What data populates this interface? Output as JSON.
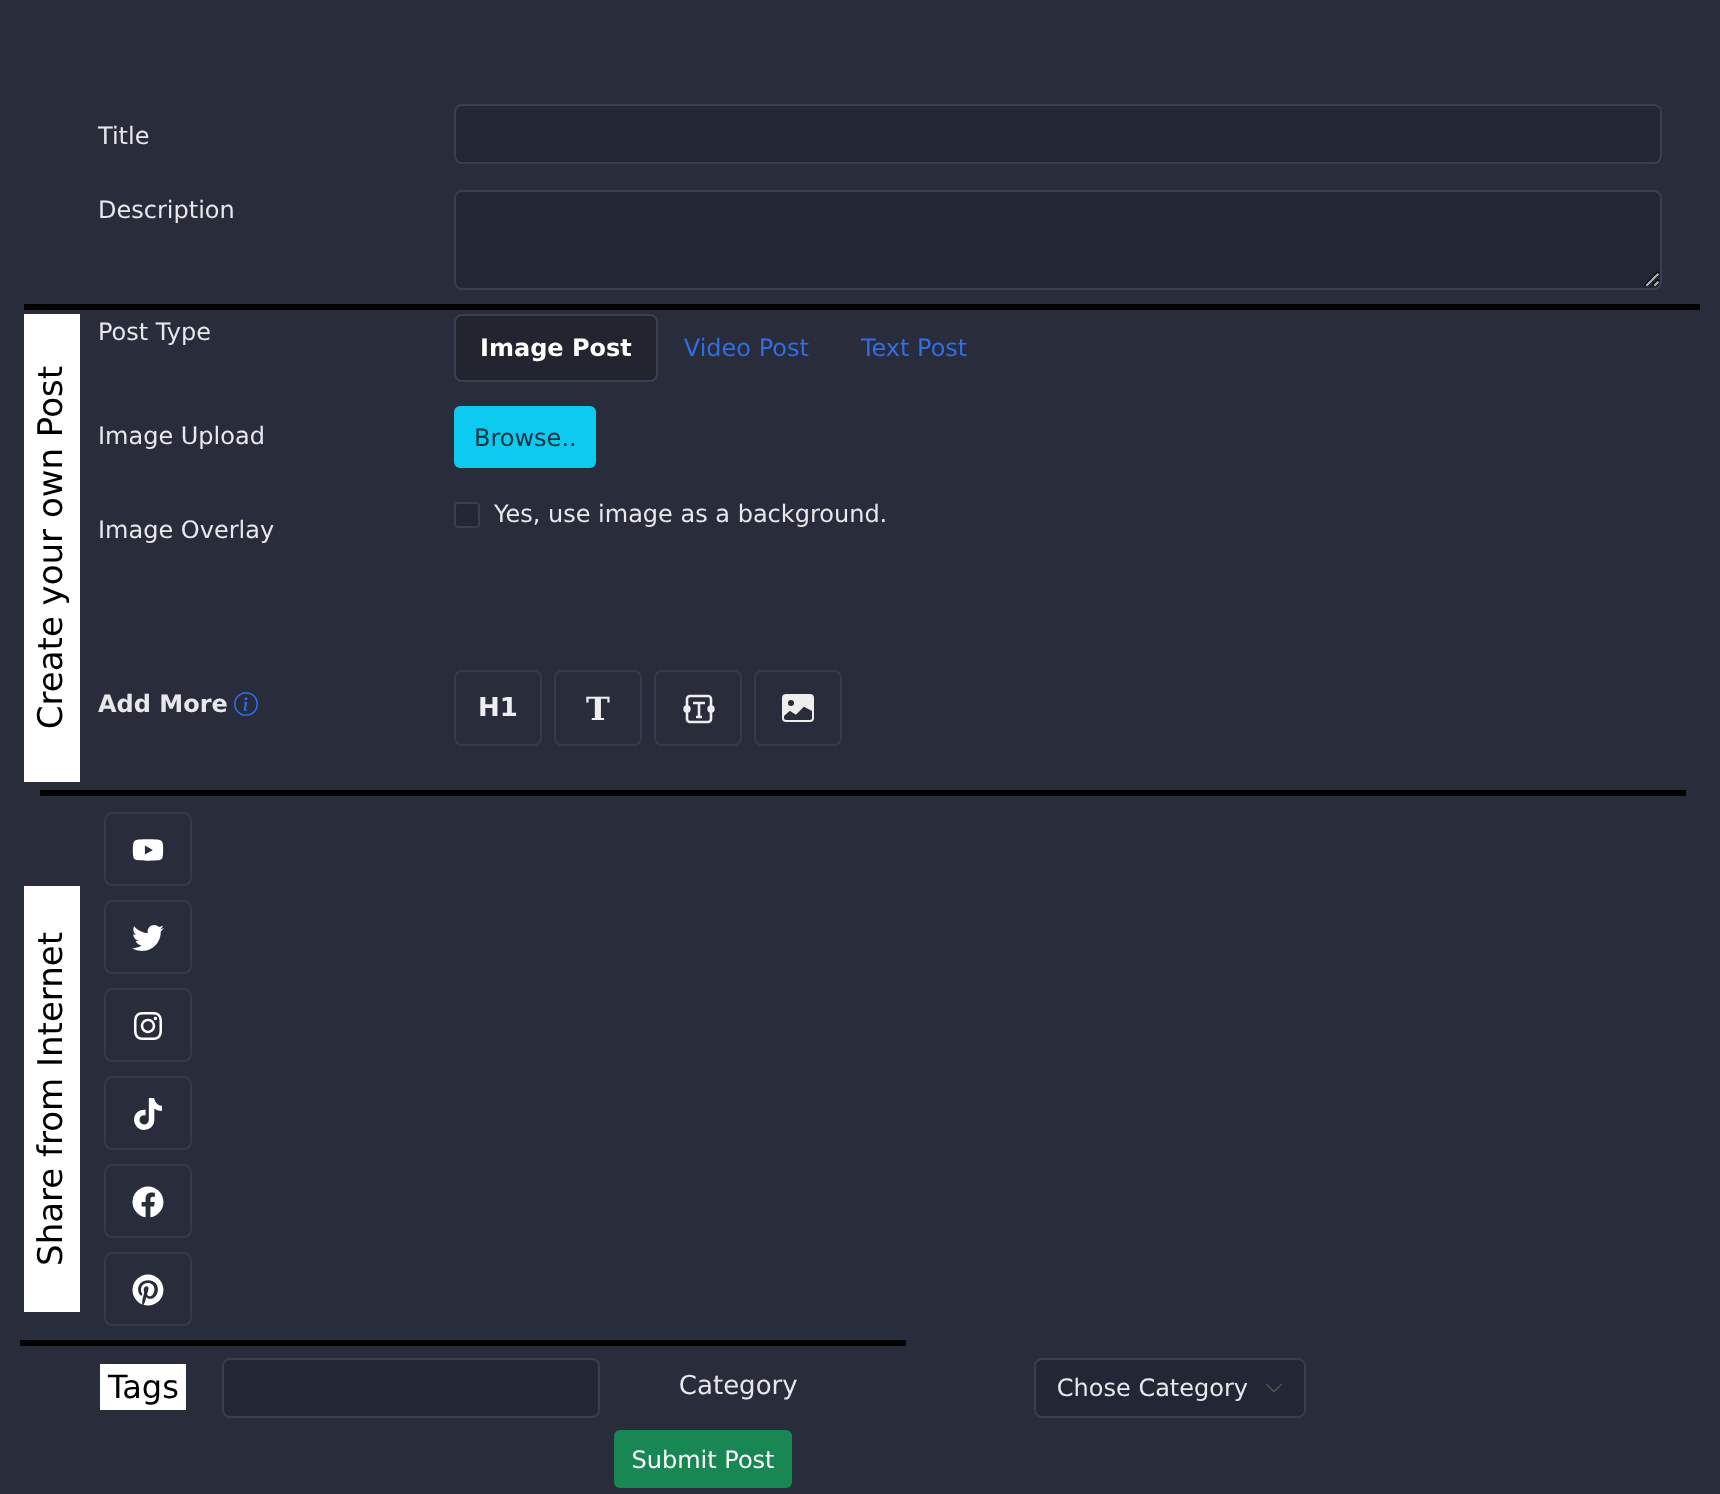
{
  "fields": [
    {
      "label": "Title",
      "kind": "input"
    },
    {
      "label": "Description",
      "kind": "textarea"
    }
  ],
  "create_section": {
    "heading": "Create your own Post",
    "post_type": {
      "label": "Post Type",
      "options": [
        {
          "label": "Image Post",
          "selected": true
        },
        {
          "label": "Video Post",
          "selected": false
        },
        {
          "label": "Text Post",
          "selected": false
        }
      ]
    },
    "image_upload": {
      "label": "Image Upload",
      "button": "Browse.."
    },
    "image_overlay": {
      "label": "Image Overlay",
      "option": "Yes, use image as a background.",
      "checked": false
    },
    "add_more": {
      "label": "Add More",
      "tools": [
        {
          "kind": "text",
          "label": "H1"
        },
        {
          "kind": "serif-text",
          "label": "T"
        },
        {
          "kind": "textbox"
        },
        {
          "kind": "image"
        }
      ]
    }
  },
  "share_section": {
    "heading": "Share from Internet",
    "sources": [
      {
        "kind": "youtube"
      },
      {
        "kind": "twitter"
      },
      {
        "kind": "instagram"
      },
      {
        "kind": "tiktok"
      },
      {
        "kind": "facebook"
      },
      {
        "kind": "pinterest"
      }
    ]
  },
  "footer": {
    "tags_label": "Tags",
    "category_label": "Category",
    "category_select": "Chose Category",
    "submit": "Submit Post"
  }
}
